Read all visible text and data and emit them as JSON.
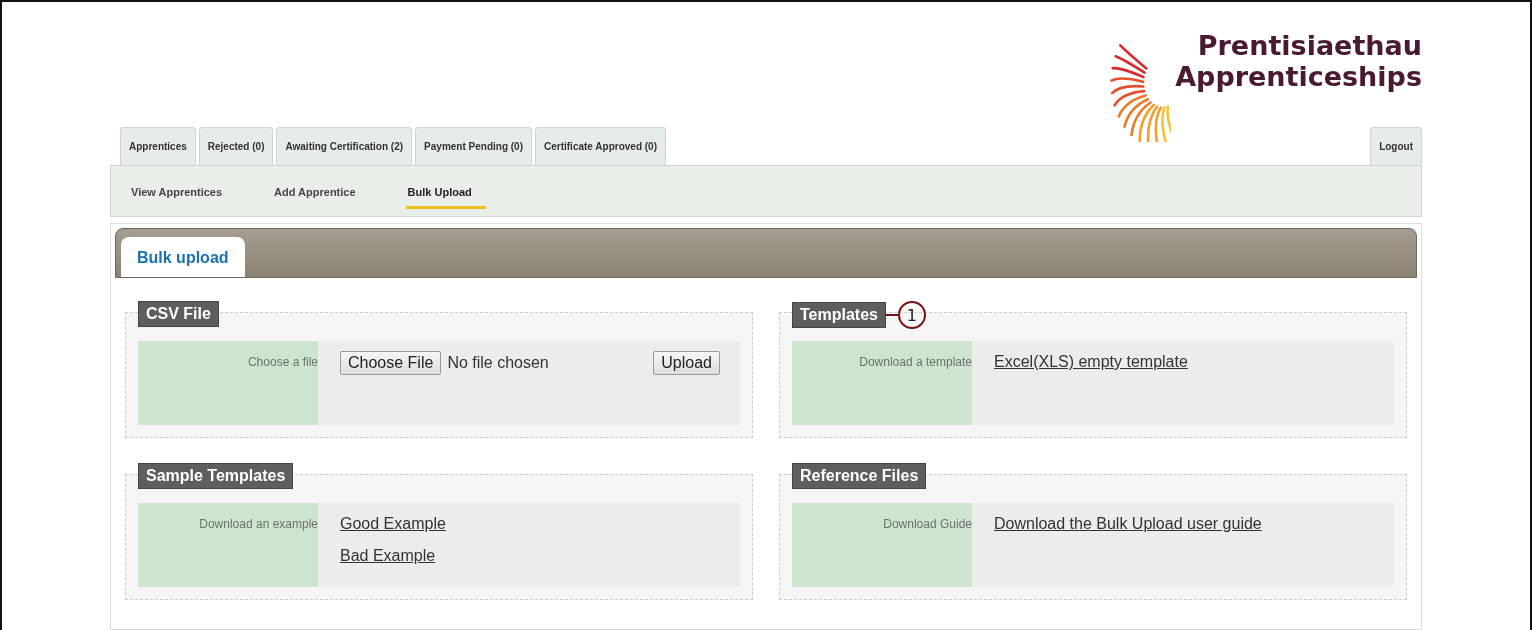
{
  "logo": {
    "line_1": "Prentisiaethau",
    "line_2": "Apprenticeships"
  },
  "tabs": [
    {
      "label": "Apprentices",
      "selected": false
    },
    {
      "label": "Rejected (0)",
      "selected": false
    },
    {
      "label": "Awaiting Certification (2)",
      "selected": false
    },
    {
      "label": "Payment Pending (0)",
      "selected": false
    },
    {
      "label": "Certificate Approved (0)",
      "selected": false
    }
  ],
  "logout": "Logout",
  "subnav": [
    {
      "label": "View Apprentices",
      "selected": false
    },
    {
      "label": "Add Apprentice",
      "selected": false
    },
    {
      "label": "Bulk Upload",
      "selected": true
    }
  ],
  "panel_tab": "Bulk upload",
  "columns": [
    [
      {
        "title": "CSV File",
        "label": "Choose a file",
        "kind": "file",
        "choose_button": "Choose File",
        "file_status": "No file chosen",
        "upload_button": "Upload"
      },
      {
        "title": "Sample Templates",
        "label": "Download an example",
        "kind": "links",
        "links": [
          "Good Example",
          "Bad Example"
        ]
      }
    ],
    [
      {
        "title": "Templates",
        "callout": "1",
        "label": "Download a template",
        "kind": "links",
        "links": [
          "Excel(XLS) empty template"
        ]
      },
      {
        "title": "Reference Files",
        "label": "Download Guide",
        "kind": "links",
        "links": [
          "Download the Bulk Upload user guide"
        ]
      }
    ]
  ]
}
